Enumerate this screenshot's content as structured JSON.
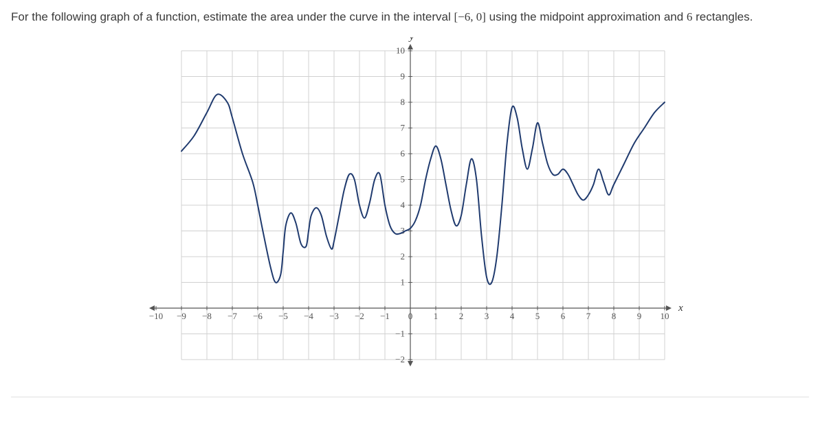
{
  "question": {
    "prefix": "For the following graph of a function, estimate the area under the curve in the interval ",
    "interval": "[−6, 0]",
    "middle": " using the midpoint approximation and ",
    "count": "6",
    "suffix": " rectangles."
  },
  "chart_data": {
    "type": "line",
    "xlabel": "x",
    "ylabel": "y",
    "xlim": [
      -10,
      10
    ],
    "ylim": [
      -2,
      10
    ],
    "xticks": [
      -10,
      -9,
      -8,
      -7,
      -6,
      -5,
      -4,
      -3,
      -2,
      -1,
      0,
      1,
      2,
      3,
      4,
      5,
      6,
      7,
      8,
      9,
      10
    ],
    "yticks": [
      -2,
      -1,
      0,
      1,
      2,
      3,
      4,
      5,
      6,
      7,
      8,
      9,
      10
    ],
    "x": [
      -9.0,
      -8.5,
      -8.0,
      -7.6,
      -7.2,
      -7.0,
      -6.6,
      -6.2,
      -6.0,
      -5.8,
      -5.5,
      -5.3,
      -5.1,
      -5.0,
      -4.9,
      -4.7,
      -4.5,
      -4.3,
      -4.1,
      -4.0,
      -3.9,
      -3.7,
      -3.5,
      -3.3,
      -3.1,
      -3.0,
      -2.8,
      -2.6,
      -2.4,
      -2.2,
      -2.0,
      -1.8,
      -1.6,
      -1.4,
      -1.2,
      -1.0,
      -0.8,
      -0.6,
      -0.4,
      -0.2,
      0.0,
      0.2,
      0.4,
      0.6,
      0.8,
      1.0,
      1.2,
      1.4,
      1.6,
      1.8,
      2.0,
      2.2,
      2.4,
      2.6,
      2.8,
      3.0,
      3.2,
      3.4,
      3.6,
      3.8,
      4.0,
      4.2,
      4.4,
      4.6,
      4.8,
      5.0,
      5.2,
      5.4,
      5.6,
      5.8,
      6.0,
      6.2,
      6.4,
      6.6,
      6.8,
      7.0,
      7.2,
      7.4,
      7.6,
      7.8,
      8.0,
      8.4,
      8.8,
      9.2,
      9.6,
      10.0
    ],
    "y": [
      6.1,
      6.7,
      7.6,
      8.3,
      8.0,
      7.4,
      6.0,
      4.9,
      4.0,
      3.0,
      1.6,
      1.0,
      1.3,
      2.2,
      3.2,
      3.7,
      3.3,
      2.5,
      2.4,
      3.0,
      3.6,
      3.9,
      3.6,
      2.8,
      2.3,
      2.6,
      3.6,
      4.6,
      5.2,
      5.0,
      4.0,
      3.5,
      4.1,
      5.0,
      5.2,
      4.0,
      3.2,
      2.9,
      2.9,
      3.0,
      3.1,
      3.4,
      4.0,
      5.0,
      5.8,
      6.3,
      5.8,
      4.8,
      3.8,
      3.2,
      3.6,
      4.8,
      5.8,
      5.0,
      2.8,
      1.2,
      1.0,
      2.0,
      4.0,
      6.4,
      7.8,
      7.4,
      6.2,
      5.4,
      6.2,
      7.2,
      6.4,
      5.6,
      5.2,
      5.2,
      5.4,
      5.2,
      4.8,
      4.4,
      4.2,
      4.4,
      4.8,
      5.4,
      4.9,
      4.4,
      4.8,
      5.6,
      6.4,
      7.0,
      7.6,
      8.0
    ]
  }
}
